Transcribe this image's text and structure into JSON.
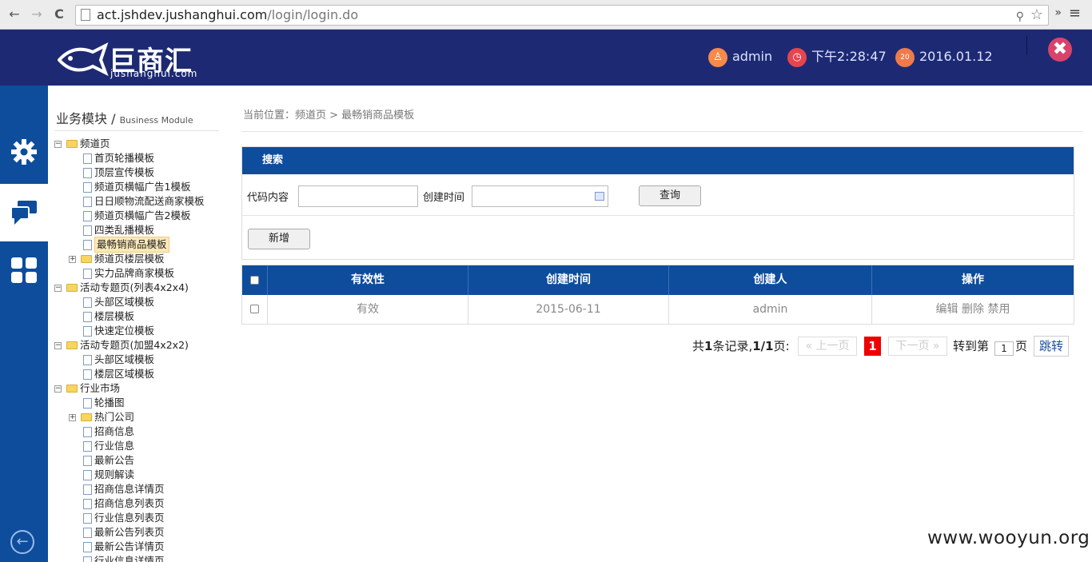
{
  "browser": {
    "url_host": "act.jshdev.jushanghui.com",
    "url_path": "/login/login.do",
    "back_icon": "←",
    "forward_icon": "→",
    "reload_icon": "C",
    "more_icon": "»"
  },
  "header": {
    "logo_text": "巨商汇",
    "logo_sub": "jushanghui.com",
    "user": "admin",
    "time": "下午2:28:47",
    "date": "2016.01.12",
    "calendar_day": "20",
    "close_symbol": "✖"
  },
  "sidebar": {
    "title": "业务模块",
    "title_sep": "/",
    "title_en": "Business Module",
    "tree": [
      {
        "label": "频道页",
        "type": "folder",
        "level": 0,
        "toggle": "−"
      },
      {
        "label": "首页轮播模板",
        "type": "doc",
        "level": 1
      },
      {
        "label": "顶层宣传模板",
        "type": "doc",
        "level": 1
      },
      {
        "label": "频道页横幅广告1模板",
        "type": "doc",
        "level": 1
      },
      {
        "label": "日日顺物流配送商家模板",
        "type": "doc",
        "level": 1
      },
      {
        "label": "频道页横幅广告2模板",
        "type": "doc",
        "level": 1
      },
      {
        "label": "四类乱播模板",
        "type": "doc",
        "level": 1
      },
      {
        "label": "最畅销商品模板",
        "type": "doc",
        "level": 1,
        "selected": true
      },
      {
        "label": "频道页楼层模板",
        "type": "folder",
        "level": 1,
        "toggle": "+"
      },
      {
        "label": "实力品牌商家模板",
        "type": "doc",
        "level": 1
      },
      {
        "label": "活动专题页(列表4x2x4)",
        "type": "folder",
        "level": 0,
        "toggle": "−"
      },
      {
        "label": "头部区域模板",
        "type": "doc",
        "level": 1
      },
      {
        "label": "楼层模板",
        "type": "doc",
        "level": 1
      },
      {
        "label": "快速定位模板",
        "type": "doc",
        "level": 1
      },
      {
        "label": "活动专题页(加盟4x2x2)",
        "type": "folder",
        "level": 0,
        "toggle": "−"
      },
      {
        "label": "头部区域模板",
        "type": "doc",
        "level": 1
      },
      {
        "label": "楼层区域模板",
        "type": "doc",
        "level": 1
      },
      {
        "label": "行业市场",
        "type": "folder",
        "level": 0,
        "toggle": "−"
      },
      {
        "label": "轮播图",
        "type": "doc",
        "level": 1
      },
      {
        "label": "热门公司",
        "type": "folder",
        "level": 1,
        "toggle": "+"
      },
      {
        "label": "招商信息",
        "type": "doc",
        "level": 1
      },
      {
        "label": "行业信息",
        "type": "doc",
        "level": 1
      },
      {
        "label": "最新公告",
        "type": "doc",
        "level": 1
      },
      {
        "label": "规则解读",
        "type": "doc",
        "level": 1
      },
      {
        "label": "招商信息详情页",
        "type": "doc",
        "level": 1
      },
      {
        "label": "招商信息列表页",
        "type": "doc",
        "level": 1
      },
      {
        "label": "行业信息列表页",
        "type": "doc",
        "level": 1
      },
      {
        "label": "最新公告列表页",
        "type": "doc",
        "level": 1
      },
      {
        "label": "最新公告详情页",
        "type": "doc",
        "level": 1
      },
      {
        "label": "行业信息详情页",
        "type": "doc",
        "level": 1
      }
    ]
  },
  "main": {
    "breadcrumb": "当前位置：频道页 > 最畅销商品模板",
    "search": {
      "title": "搜索",
      "code_label": "代码内容",
      "code_value": "",
      "time_label": "创建时间",
      "time_value": "",
      "query_button": "查询",
      "add_button": "新增"
    },
    "table": {
      "columns": [
        "有效性",
        "创建时间",
        "创建人",
        "操作"
      ],
      "rows": [
        {
          "validity": "有效",
          "created": "2015-06-11",
          "creator": "admin",
          "actions": [
            "编辑",
            "删除",
            "禁用"
          ]
        }
      ]
    },
    "pager": {
      "summary_prefix": "共",
      "total": "1",
      "summary_mid": "条记录,",
      "pages": "1/1",
      "summary_suffix": "页:",
      "prev": "« 上一页",
      "current": "1",
      "next": "下一页 »",
      "goto_prefix": "转到第",
      "goto_value": "1",
      "goto_suffix": "页",
      "go_button": "跳转"
    }
  },
  "watermark": "www.wooyun.org"
}
